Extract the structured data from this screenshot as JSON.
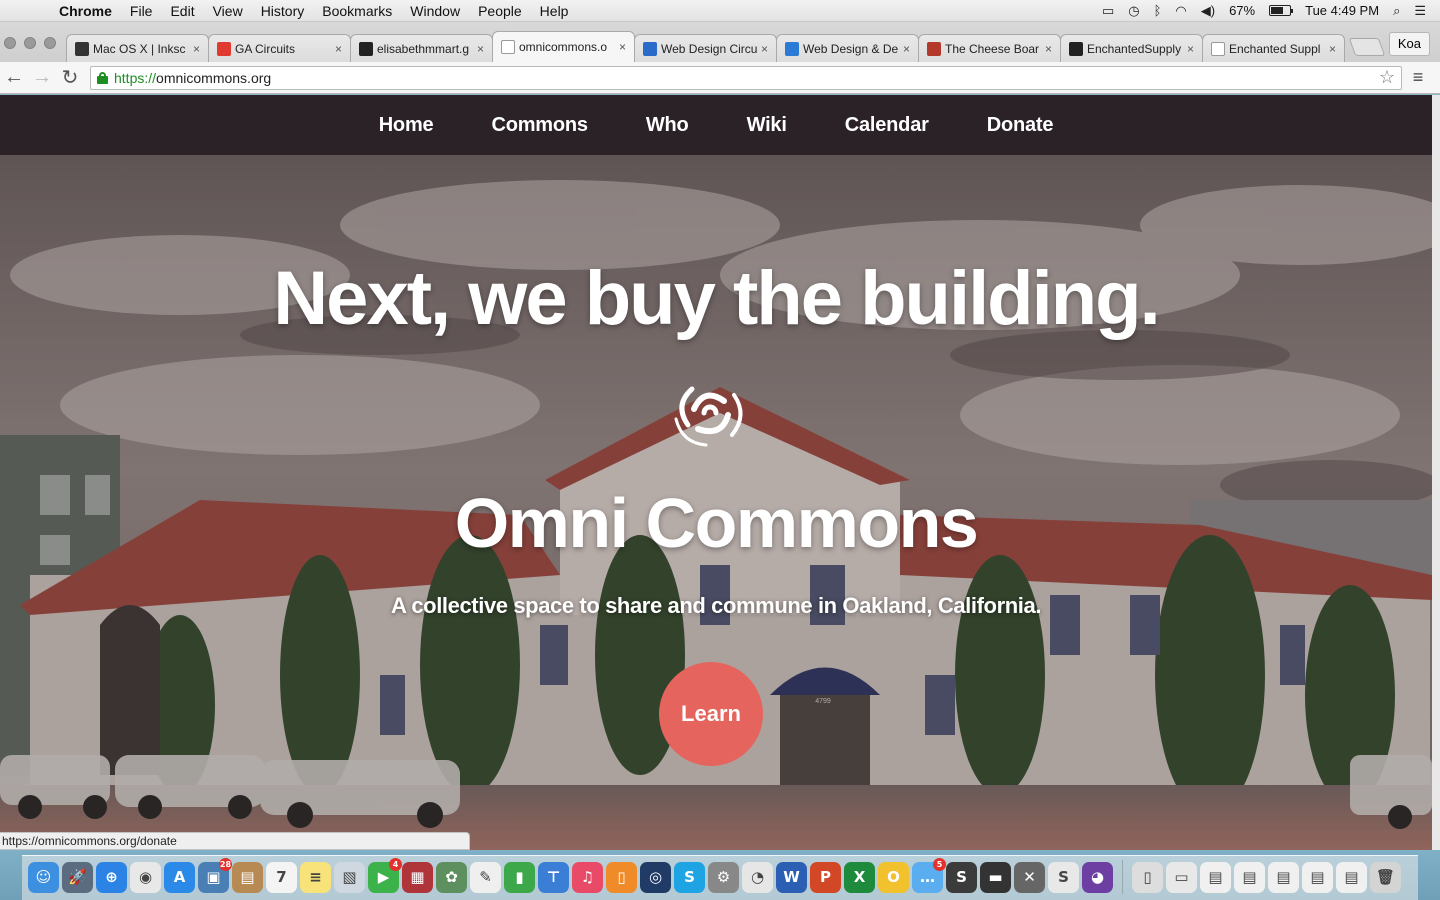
{
  "menubar": {
    "app_name": "Chrome",
    "menus": [
      "File",
      "Edit",
      "View",
      "History",
      "Bookmarks",
      "Window",
      "People",
      "Help"
    ],
    "battery_percent": "67%",
    "battery_level": 0.67,
    "clock": "Tue 4:49 PM"
  },
  "tabs": [
    {
      "title": "Mac OS X | Inksc",
      "favicon": "inkscape-icon",
      "color": "#333333"
    },
    {
      "title": "GA Circuits",
      "favicon": "ga-icon",
      "color": "#e03a31"
    },
    {
      "title": "elisabethmmart.g",
      "favicon": "github-icon",
      "color": "#222222"
    },
    {
      "title": "omnicommons.o",
      "favicon": "document-icon",
      "color": "#ffffff",
      "active": true
    },
    {
      "title": "Web Design Circu",
      "favicon": "trello-icon",
      "color": "#2a6bc9"
    },
    {
      "title": "Web Design & De",
      "favicon": "drop-icon",
      "color": "#2a7ad6"
    },
    {
      "title": "The Cheese Boar",
      "favicon": "cb-icon",
      "color": "#b33a2b"
    },
    {
      "title": "EnchantedSupply",
      "favicon": "github-icon",
      "color": "#222222"
    },
    {
      "title": "Enchanted Suppl",
      "favicon": "document-icon",
      "color": "#ffffff"
    }
  ],
  "profile_name": "Koa",
  "address": {
    "scheme": "https://",
    "host": "omnicommons.org"
  },
  "site": {
    "nav": [
      "Home",
      "Commons",
      "Who",
      "Wiki",
      "Calendar",
      "Donate"
    ],
    "headline": "Next, we buy the building.",
    "brand": "Omni Commons",
    "tagline": "A collective space to share and commune in Oakland, California.",
    "cta": "Learn",
    "cta_color": "#e5645e",
    "nav_color": "#2a2227",
    "building_number": "4799"
  },
  "status_url": "https://omnicommons.org/donate",
  "dock": [
    {
      "name": "finder-icon",
      "color": "#3d8fe0",
      "glyph": "☺"
    },
    {
      "name": "launchpad-icon",
      "color": "#5b6c80",
      "glyph": "🚀"
    },
    {
      "name": "safari-icon",
      "color": "#2b83e6",
      "glyph": "⊕"
    },
    {
      "name": "chrome-icon",
      "color": "#e8e8e8",
      "glyph": "◉"
    },
    {
      "name": "appstore-icon",
      "color": "#2b8ae8",
      "glyph": "A"
    },
    {
      "name": "photo-icon",
      "color": "#4a7fb5",
      "glyph": "▣",
      "badge": "28"
    },
    {
      "name": "contacts-icon",
      "color": "#b88a53",
      "glyph": "▤"
    },
    {
      "name": "calendar-icon",
      "color": "#f4f4f4",
      "glyph": "7"
    },
    {
      "name": "notes-icon",
      "color": "#f7e37a",
      "glyph": "≡"
    },
    {
      "name": "preview-icon",
      "color": "#cfd8e0",
      "glyph": "▧"
    },
    {
      "name": "facetime-icon",
      "color": "#3cb24a",
      "glyph": "▶",
      "badge": "4"
    },
    {
      "name": "photobooth-icon",
      "color": "#b0353b",
      "glyph": "▦"
    },
    {
      "name": "iphoto-icon",
      "color": "#5e8f5f",
      "glyph": "✿"
    },
    {
      "name": "textedit-icon",
      "color": "#efefef",
      "glyph": "✎"
    },
    {
      "name": "numbers-icon",
      "color": "#3ca84a",
      "glyph": "▮"
    },
    {
      "name": "keynote-icon",
      "color": "#3b7ed6",
      "glyph": "⊤"
    },
    {
      "name": "itunes-icon",
      "color": "#e94a67",
      "glyph": "♫"
    },
    {
      "name": "ibooks-icon",
      "color": "#f08b2a",
      "glyph": "▯"
    },
    {
      "name": "dashcode-icon",
      "color": "#203b66",
      "glyph": "◎"
    },
    {
      "name": "skype-icon",
      "color": "#1fa4e3",
      "glyph": "S"
    },
    {
      "name": "sysprefs-icon",
      "color": "#888888",
      "glyph": "⚙"
    },
    {
      "name": "cyberduck-icon",
      "color": "#e6e6e6",
      "glyph": "◔"
    },
    {
      "name": "word-icon",
      "color": "#2b5fb4",
      "glyph": "W"
    },
    {
      "name": "powerpoint-icon",
      "color": "#d24726",
      "glyph": "P"
    },
    {
      "name": "excel-icon",
      "color": "#1e8a3c",
      "glyph": "X"
    },
    {
      "name": "outlook-icon",
      "color": "#f2c12e",
      "glyph": "O"
    },
    {
      "name": "messages-icon",
      "color": "#5aaef0",
      "glyph": "…",
      "badge": "5"
    },
    {
      "name": "sublime-icon",
      "color": "#3b3b3b",
      "glyph": "S"
    },
    {
      "name": "printer-icon",
      "color": "#333333",
      "glyph": "▬"
    },
    {
      "name": "x11-icon",
      "color": "#666666",
      "glyph": "✕"
    },
    {
      "name": "slack-icon",
      "color": "#e8e8e8",
      "glyph": "S"
    },
    {
      "name": "github-desktop-icon",
      "color": "#6e3fa3",
      "glyph": "◕"
    }
  ],
  "dock_right": [
    {
      "name": "document-stack-icon",
      "color": "#dddddd",
      "glyph": "▯"
    },
    {
      "name": "mail-stack-icon",
      "color": "#e8e8e8",
      "glyph": "▭"
    },
    {
      "name": "screenshot-1-icon",
      "color": "#f0f0f0",
      "glyph": "▤"
    },
    {
      "name": "screenshot-2-icon",
      "color": "#f0f0f0",
      "glyph": "▤"
    },
    {
      "name": "screenshot-3-icon",
      "color": "#f0f0f0",
      "glyph": "▤"
    },
    {
      "name": "screenshot-4-icon",
      "color": "#f0f0f0",
      "glyph": "▤"
    },
    {
      "name": "screenshot-5-icon",
      "color": "#f0f0f0",
      "glyph": "▤"
    },
    {
      "name": "trash-icon",
      "color": "#d4d4d4",
      "glyph": "🗑"
    }
  ]
}
